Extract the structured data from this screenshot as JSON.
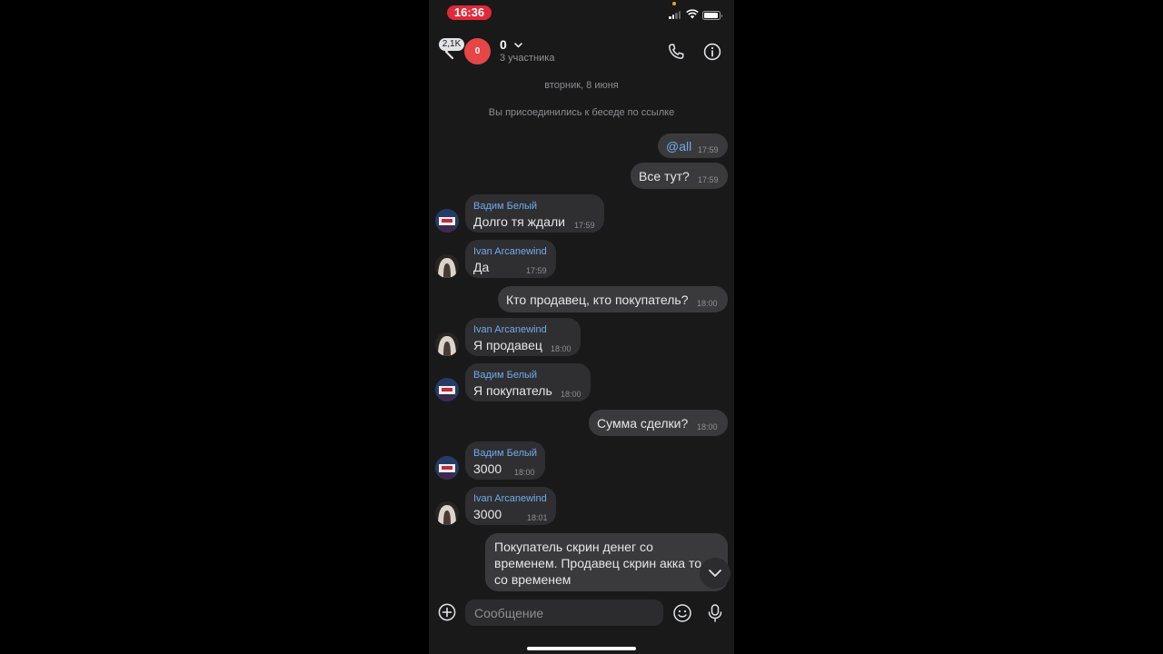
{
  "status_bar": {
    "time": "16:36"
  },
  "header": {
    "back_badge": "2,1K",
    "avatar_letter": "0",
    "title": "0",
    "subtitle": "3 участника"
  },
  "system": {
    "date": "вторник, 8 июня",
    "joined": "Вы присоединились к беседе по ссылке"
  },
  "messages": [
    {
      "author": "",
      "text": "@all",
      "time": "17:59"
    },
    {
      "author": "",
      "text": "Все тут?",
      "time": "17:59"
    },
    {
      "author": "Вадим Белый",
      "text": "Долго тя ждали",
      "time": "17:59"
    },
    {
      "author": "Ivan Arcanewind",
      "text": "Да",
      "time": "17:59"
    },
    {
      "author": "",
      "text": "Кто продавец, кто покупатель?",
      "time": "18:00"
    },
    {
      "author": "Ivan Arcanewind",
      "text": "Я продавец",
      "time": "18:00"
    },
    {
      "author": "Вадим Белый",
      "text": "Я покупатель",
      "time": "18:00"
    },
    {
      "author": "",
      "text": "Сумма сделки?",
      "time": "18:00"
    },
    {
      "author": "Вадим Белый",
      "text": "3000",
      "time": "18:00"
    },
    {
      "author": "Ivan Arcanewind",
      "text": "3000",
      "time": "18:01"
    },
    {
      "author": "",
      "lines": [
        "Покупатель скрин денег со",
        "временем. Продавец скрин акка то",
        "со временем"
      ],
      "time": ""
    }
  ],
  "composer": {
    "placeholder": "Сообщение"
  },
  "colors": {
    "accent": "#71aaeb",
    "badge_red": "#e0293a",
    "avatar_red": "#e64646",
    "background": "#19191a"
  },
  "icons": [
    "back-icon",
    "phone-icon",
    "info-icon",
    "chevron-down-icon",
    "plus-icon",
    "emoji-icon",
    "microphone-icon",
    "scroll-down-icon"
  ]
}
